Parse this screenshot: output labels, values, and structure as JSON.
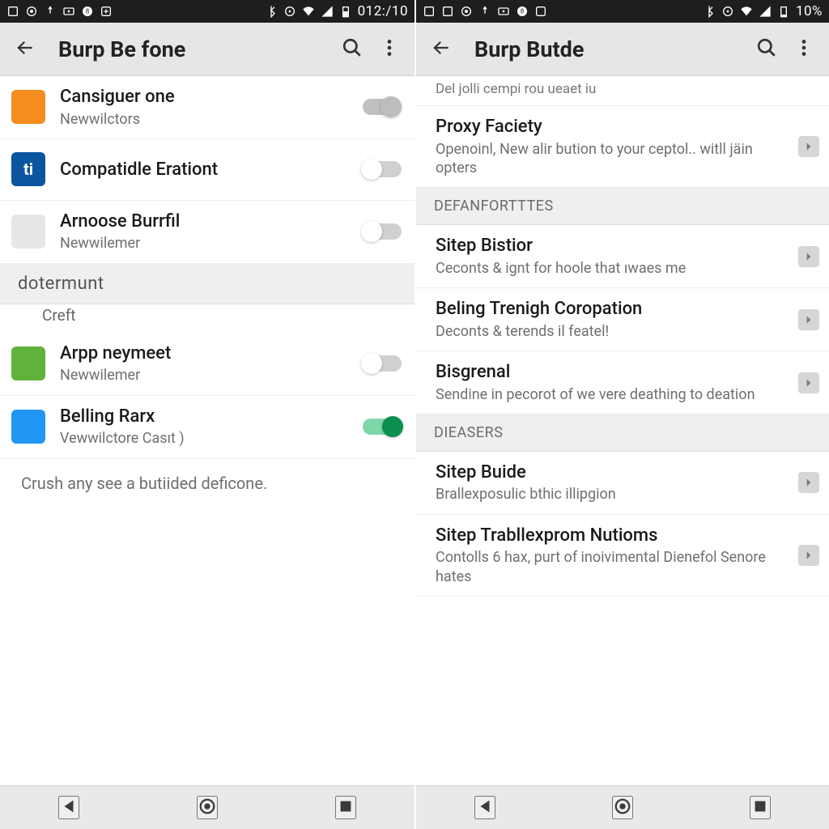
{
  "left": {
    "status": {
      "clock": "012:/10"
    },
    "appbar": {
      "title": "Burp Be fone"
    },
    "rows": [
      {
        "icon_bg": "#f58c1f",
        "icon_txt": "",
        "title": "Cansiguer one",
        "sub": "Newwilctors",
        "toggle": "half"
      },
      {
        "icon_bg": "#0b54a0",
        "icon_txt": "ti",
        "title": "Compatidle Erationt",
        "sub": "",
        "toggle": "off2"
      },
      {
        "icon_bg": "#e7e7e7",
        "icon_txt": "",
        "title": "Arnoose Burrfil",
        "sub": "Newwilemer",
        "toggle": "off2"
      }
    ],
    "section1": "dotermunt",
    "section1_sub": "Creft",
    "rows2": [
      {
        "icon_bg": "#61b23a",
        "icon_txt": "",
        "title": "Arpp neymeet",
        "sub": "Newwilemer",
        "toggle": "off2"
      },
      {
        "icon_bg": "#2196f3",
        "icon_txt": "",
        "title": "Belling Rarx",
        "sub": "Vewwilctore Casıt )",
        "toggle": "on"
      }
    ],
    "footer_note": "Crush any see a butiided deficone."
  },
  "right": {
    "status": {
      "clock": "10%"
    },
    "appbar": {
      "title": "Burp Butde"
    },
    "truncated_top": "Del jolli cempi rou ueaet iu",
    "top_row": {
      "title": "Proxy Faciety",
      "sub": "Openoinl, New alir bution to your ceptol.. witll jäin opters"
    },
    "section_a": "DEFANFORTTTES",
    "rows_a": [
      {
        "title": "Sitep Bistior",
        "sub": "Ceconts & ignt for hoole that ıwaes me"
      },
      {
        "title": "Beling Trenigh Coropation",
        "sub": "Deconts & terends il featel!"
      },
      {
        "title": "Bisgrenal",
        "sub": "Sendine in pecorot of we vere deathing to deation"
      }
    ],
    "section_b": "DIEASERS",
    "rows_b": [
      {
        "title": "Sitep Buide",
        "sub": "Brallexposulic bthic illipgion"
      },
      {
        "title": "Sitep Trabllexprom Nutioms",
        "sub": "Contolls 6 hax, purt of inoivimental Dienefol Senore hates"
      }
    ]
  }
}
